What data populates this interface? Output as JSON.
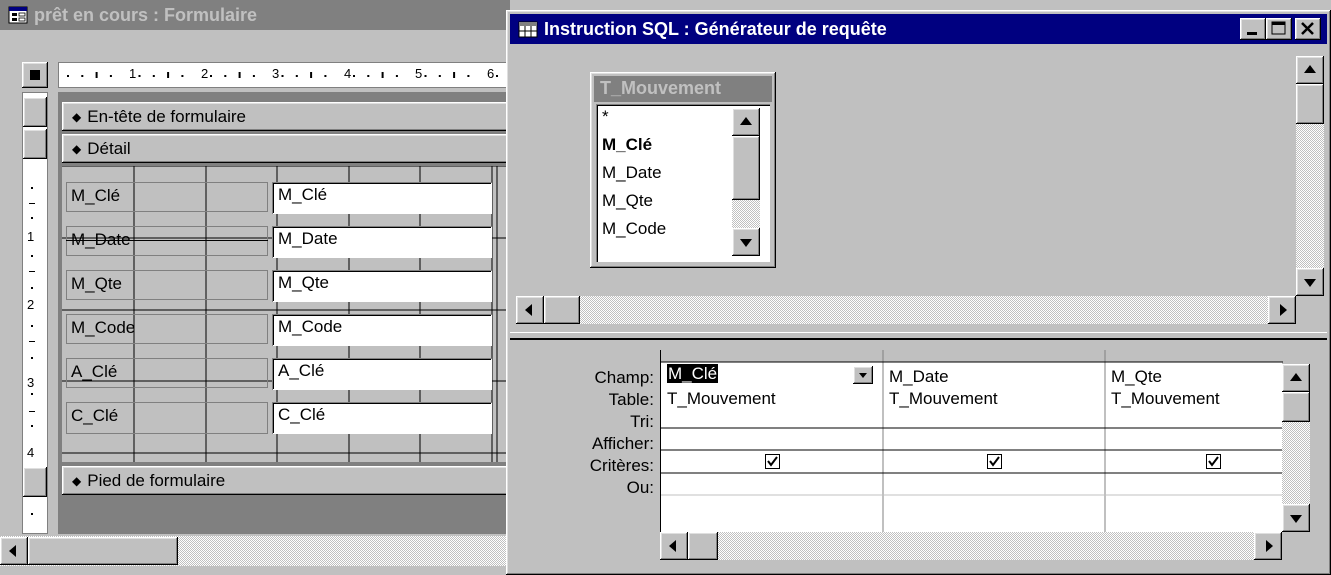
{
  "form_window": {
    "title": "prêt en cours : Formulaire",
    "ruler_numbers": [
      "1",
      "2",
      "3",
      "4",
      "5",
      "6"
    ],
    "vertical_ruler_numbers": [
      "1",
      "2",
      "3",
      "4"
    ],
    "sections": {
      "header": "En-tête de formulaire",
      "detail": "Détail",
      "footer": "Pied de formulaire"
    },
    "controls": [
      {
        "label": "M_Clé",
        "field": "M_Clé"
      },
      {
        "label": "M_Date",
        "field": "M_Date"
      },
      {
        "label": "M_Qte",
        "field": "M_Qte"
      },
      {
        "label": "M_Code",
        "field": "M_Code"
      },
      {
        "label": "A_Clé",
        "field": "A_Clé"
      },
      {
        "label": "C_Clé",
        "field": "C_Clé"
      }
    ]
  },
  "query_window": {
    "title": "Instruction SQL : Générateur de requête",
    "table": {
      "name": "T_Mouvement",
      "fields": [
        "*",
        "M_Clé",
        "M_Date",
        "M_Qte",
        "M_Code"
      ]
    },
    "grid": {
      "row_labels": [
        "Champ:",
        "Table:",
        "Tri:",
        "Afficher:",
        "Critères:",
        "Ou:"
      ],
      "columns": [
        {
          "champ": "M_Clé",
          "table": "T_Mouvement",
          "tri": "",
          "afficher": true
        },
        {
          "champ": "M_Date",
          "table": "T_Mouvement",
          "tri": "",
          "afficher": true
        },
        {
          "champ": "M_Qte",
          "table": "T_Mouvement",
          "tri": "",
          "afficher": true
        }
      ]
    }
  },
  "colors": {
    "active_title": "#000080",
    "inactive_title": "#808080",
    "face": "#c0c0c0"
  }
}
